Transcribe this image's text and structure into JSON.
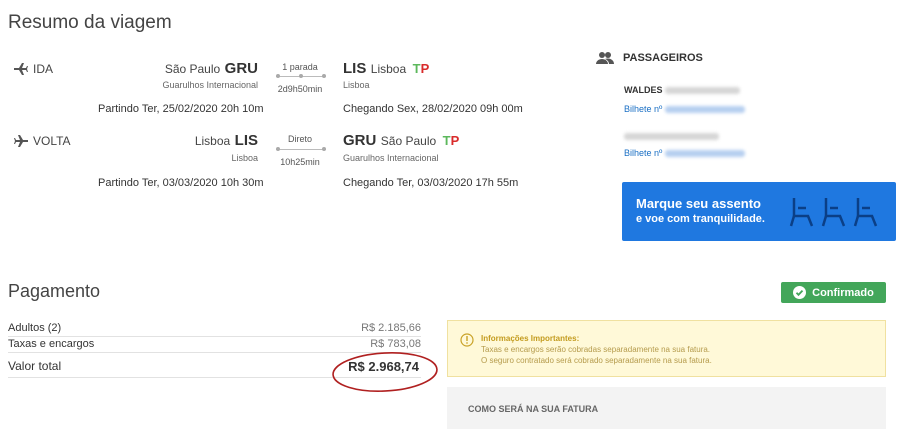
{
  "trip": {
    "title": "Resumo da viagem",
    "outbound": {
      "direction": "IDA",
      "origin_city": "São Paulo",
      "origin_code": "GRU",
      "origin_airport": "Guarulhos Internacional",
      "stops": "1 parada",
      "duration": "2d9h50min",
      "dest_code": "LIS",
      "dest_city": "Lisboa",
      "dest_airport": "Lisboa",
      "departure": "Partindo Ter, 25/02/2020 20h 10m",
      "arrival": "Chegando Sex, 28/02/2020 09h 00m"
    },
    "return": {
      "direction": "VOLTA",
      "origin_city": "Lisboa",
      "origin_code": "LIS",
      "origin_airport": "Lisboa",
      "stops": "Direto",
      "duration": "10h25min",
      "dest_code": "GRU",
      "dest_city": "São Paulo",
      "dest_airport": "Guarulhos Internacional",
      "departure": "Partindo Ter, 03/03/2020 10h 30m",
      "arrival": "Chegando Ter, 03/03/2020 17h 55m"
    },
    "airline_logo": {
      "t": "T",
      "p": "P"
    }
  },
  "passengers": {
    "title": "PASSAGEIROS",
    "first_name": "WALDES",
    "ticket_label": "Bilhete nº"
  },
  "seat_banner": {
    "line1": "Marque seu assento",
    "line2": "e voe com tranquilidade."
  },
  "payment": {
    "title": "Pagamento",
    "status": "Confirmado",
    "rows": [
      {
        "label": "Adultos (2)",
        "value": "R$ 2.185,66"
      },
      {
        "label": "Taxas e encargos",
        "value": "R$ 783,08"
      }
    ],
    "total_label": "Valor total",
    "total_value": "R$ 2.968,74"
  },
  "info": {
    "title": "Informações Importantes:",
    "line1": "Taxas e encargos serão cobradas separadamente na sua fatura.",
    "line2": "O seguro contratado será cobrado separadamente na sua fatura."
  },
  "invoice": {
    "title": "COMO SERÁ NA SUA FATURA"
  },
  "colors": {
    "accent_blue": "#1f78e0",
    "confirm_green": "#43a65a",
    "tap_green": "#5cb85c",
    "tap_red": "#d92b2b",
    "circle_red": "#b02020"
  }
}
